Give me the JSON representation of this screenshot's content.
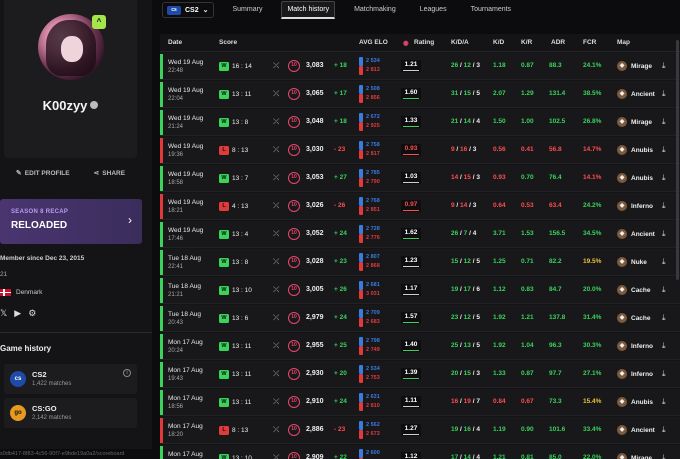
{
  "sidebar": {
    "level": "^",
    "username": "K00zyy",
    "edit_profile": "EDIT PROFILE",
    "share": "SHARE",
    "recap_line1": "SEASON 8 RECAP",
    "recap_line2": "RELOADED",
    "member_since": "Member since Dec 23, 2015",
    "member_num": "21",
    "country": "Denmark",
    "game_history_title": "Game history",
    "games": [
      {
        "name": "CS2",
        "matches": "1,422 matches",
        "logo": "cs2"
      },
      {
        "name": "CS:GO",
        "matches": "2,142 matches",
        "logo": "csgo"
      }
    ],
    "url": "s0db417-8f83-4c56-90f7-e9bde19a0a2/scoreboard"
  },
  "topbar": {
    "game": "CS2",
    "logo": "cs2",
    "tabs": [
      "Summary",
      "Match history",
      "Matchmaking",
      "Leagues",
      "Tournaments"
    ],
    "active_tab": "Match history"
  },
  "table": {
    "headers": {
      "date": "Date",
      "score": "Score",
      "avg_elo": "AVG ELO",
      "rating": "Rating",
      "kda": "K/D/A",
      "kd": "K/D",
      "kr": "K/R",
      "adr": "ADR",
      "fcr": "FCR",
      "map": "Map"
    },
    "rows": [
      {
        "date": "Wed 19 Aug",
        "time": "22:48",
        "result": "W",
        "score": "16 : 14",
        "level": "10",
        "elo": "3,083",
        "delta": "+ 18",
        "elo_a": "2 534",
        "elo_b": "2 813",
        "rating": "1.21",
        "k": "26",
        "d": "12",
        "a": "3",
        "kd": "1.18",
        "kr": "0.87",
        "adr": "88.3",
        "fcr": "24.1%",
        "map": "Mirage"
      },
      {
        "date": "Wed 19 Aug",
        "time": "22:04",
        "result": "W",
        "score": "13 : 11",
        "level": "10",
        "elo": "3,065",
        "delta": "+ 17",
        "elo_a": "2 508",
        "elo_b": "2 856",
        "rating": "1.60",
        "k": "31",
        "d": "15",
        "a": "5",
        "kd": "2.07",
        "kr": "1.29",
        "adr": "131.4",
        "fcr": "38.5%",
        "map": "Ancient"
      },
      {
        "date": "Wed 19 Aug",
        "time": "21:24",
        "result": "W",
        "score": "13 : 8",
        "level": "10",
        "elo": "3,048",
        "delta": "+ 18",
        "elo_a": "2 672",
        "elo_b": "2 925",
        "rating": "1.33",
        "k": "21",
        "d": "14",
        "a": "4",
        "kd": "1.50",
        "kr": "1.00",
        "adr": "102.5",
        "fcr": "26.8%",
        "map": "Mirage"
      },
      {
        "date": "Wed 19 Aug",
        "time": "19:36",
        "result": "L",
        "score": "8 : 13",
        "level": "10",
        "elo": "3,030",
        "delta": "- 23",
        "elo_a": "2 758",
        "elo_b": "2 817",
        "rating": "0.93",
        "k": "9",
        "d": "16",
        "a": "3",
        "kd": "0.56",
        "kr": "0.41",
        "adr": "56.8",
        "fcr": "14.7%",
        "map": "Anubis"
      },
      {
        "date": "Wed 19 Aug",
        "time": "18:58",
        "result": "W",
        "score": "13 : 7",
        "level": "10",
        "elo": "3,053",
        "delta": "+ 27",
        "elo_a": "2 785",
        "elo_b": "2 790",
        "rating": "1.03",
        "k": "14",
        "d": "15",
        "a": "3",
        "kd": "0.93",
        "kr": "0.70",
        "adr": "76.4",
        "fcr": "14.1%",
        "map": "Anubis"
      },
      {
        "date": "Wed 19 Aug",
        "time": "18:21",
        "result": "L",
        "score": "4 : 13",
        "level": "10",
        "elo": "3,026",
        "delta": "- 26",
        "elo_a": "2 768",
        "elo_b": "2 851",
        "rating": "0.97",
        "k": "9",
        "d": "14",
        "a": "3",
        "kd": "0.64",
        "kr": "0.53",
        "adr": "63.4",
        "fcr": "24.2%",
        "map": "Inferno"
      },
      {
        "date": "Wed 19 Aug",
        "time": "17:46",
        "result": "W",
        "score": "13 : 4",
        "level": "10",
        "elo": "3,052",
        "delta": "+ 24",
        "elo_a": "2 728",
        "elo_b": "2 776",
        "rating": "1.62",
        "k": "26",
        "d": "7",
        "a": "4",
        "kd": "3.71",
        "kr": "1.53",
        "adr": "156.5",
        "fcr": "34.5%",
        "map": "Ancient"
      },
      {
        "date": "Tue 18 Aug",
        "time": "22:41",
        "result": "W",
        "score": "13 : 8",
        "level": "10",
        "elo": "3,028",
        "delta": "+ 23",
        "elo_a": "2 807",
        "elo_b": "2 868",
        "rating": "1.23",
        "k": "15",
        "d": "12",
        "a": "5",
        "kd": "1.25",
        "kr": "0.71",
        "adr": "82.2",
        "fcr": "19.5%",
        "map": "Nuke"
      },
      {
        "date": "Tue 18 Aug",
        "time": "21:21",
        "result": "W",
        "score": "13 : 10",
        "level": "10",
        "elo": "3,005",
        "delta": "+ 26",
        "elo_a": "2 681",
        "elo_b": "3 031",
        "rating": "1.17",
        "k": "19",
        "d": "17",
        "a": "6",
        "kd": "1.12",
        "kr": "0.83",
        "adr": "84.7",
        "fcr": "20.0%",
        "map": "Cache"
      },
      {
        "date": "Tue 18 Aug",
        "time": "20:43",
        "result": "W",
        "score": "13 : 6",
        "level": "10",
        "elo": "2,979",
        "delta": "+ 24",
        "elo_a": "2 709",
        "elo_b": "2 683",
        "rating": "1.57",
        "k": "23",
        "d": "12",
        "a": "5",
        "kd": "1.92",
        "kr": "1.21",
        "adr": "137.8",
        "fcr": "31.4%",
        "map": "Cache"
      },
      {
        "date": "Mon 17 Aug",
        "time": "20:24",
        "result": "W",
        "score": "13 : 11",
        "level": "10",
        "elo": "2,955",
        "delta": "+ 25",
        "elo_a": "2 798",
        "elo_b": "2 749",
        "rating": "1.40",
        "k": "25",
        "d": "13",
        "a": "5",
        "kd": "1.92",
        "kr": "1.04",
        "adr": "96.3",
        "fcr": "30.3%",
        "map": "Inferno"
      },
      {
        "date": "Mon 17 Aug",
        "time": "19:43",
        "result": "W",
        "score": "13 : 11",
        "level": "10",
        "elo": "2,930",
        "delta": "+ 20",
        "elo_a": "2 534",
        "elo_b": "2 753",
        "rating": "1.39",
        "k": "20",
        "d": "15",
        "a": "3",
        "kd": "1.33",
        "kr": "0.87",
        "adr": "97.7",
        "fcr": "27.1%",
        "map": "Inferno"
      },
      {
        "date": "Mon 17 Aug",
        "time": "18:56",
        "result": "W",
        "score": "13 : 11",
        "level": "10",
        "elo": "2,910",
        "delta": "+ 24",
        "elo_a": "2 631",
        "elo_b": "2 810",
        "rating": "1.11",
        "k": "16",
        "d": "19",
        "a": "7",
        "kd": "0.84",
        "kr": "0.67",
        "adr": "73.3",
        "fcr": "15.4%",
        "map": "Anubis"
      },
      {
        "date": "Mon 17 Aug",
        "time": "18:20",
        "result": "L",
        "score": "8 : 13",
        "level": "10",
        "elo": "2,886",
        "delta": "- 23",
        "elo_a": "2 562",
        "elo_b": "2 673",
        "rating": "1.27",
        "k": "19",
        "d": "16",
        "a": "4",
        "kd": "1.19",
        "kr": "0.90",
        "adr": "101.6",
        "fcr": "33.4%",
        "map": "Ancient"
      },
      {
        "date": "Mon 17 Aug",
        "time": "",
        "result": "W",
        "score": "13 : 10",
        "level": "10",
        "elo": "2,909",
        "delta": "+ 22",
        "elo_a": "2 600",
        "elo_b": "2 702",
        "rating": "1.12",
        "k": "17",
        "d": "14",
        "a": "4",
        "kd": "1.21",
        "kr": "0.81",
        "adr": "85.0",
        "fcr": "22.0%",
        "map": "Mirage"
      }
    ]
  },
  "colors": {
    "win": "#3ad35c",
    "loss": "#e03a3a",
    "good": "#3ad35c",
    "bad": "#ff4d4d",
    "warn": "#e8c33a",
    "elo_blue": "#3a7be0",
    "elo_red": "#e03a3a"
  }
}
